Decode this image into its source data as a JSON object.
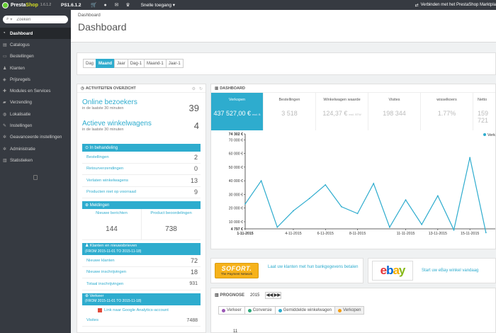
{
  "topbar": {
    "logo_presta": "Presta",
    "logo_shop": "Shop",
    "logo_version": "1.6.1.2",
    "ps_version": "PS1.6.1.2",
    "quick_access": "Snelle toegang",
    "connect": "Verbinden met het PrestaShop Marktpla"
  },
  "sidebar": {
    "search_placeholder": "Zoeken",
    "items": [
      {
        "label": "Dashboard",
        "icon": "speedometer-icon"
      },
      {
        "label": "Catalogus",
        "icon": "book-icon"
      },
      {
        "label": "Bestellingen",
        "icon": "credit-card-icon"
      },
      {
        "label": "Klanten",
        "icon": "user-icon"
      },
      {
        "label": "Prijsregels",
        "icon": "tag-icon"
      },
      {
        "label": "Modules en Services",
        "icon": "puzzle-icon"
      },
      {
        "label": "Verzending",
        "icon": "truck-icon"
      },
      {
        "label": "Lokalisatie",
        "icon": "globe-icon"
      },
      {
        "label": "Instellingen",
        "icon": "wrench-icon"
      },
      {
        "label": "Geavanceerde instellingen",
        "icon": "cogs-icon"
      },
      {
        "label": "Administratie",
        "icon": "gear-icon"
      },
      {
        "label": "Statistieken",
        "icon": "bar-chart-icon"
      }
    ]
  },
  "header": {
    "breadcrumb": "Dashboard",
    "title": "Dashboard"
  },
  "period_buttons": [
    "Dag",
    "Maand",
    "Jaar",
    "Dag-1",
    "Maand-1",
    "Jaar-1"
  ],
  "activity": {
    "title": "ACTIVITEITEN OVERZICHT",
    "online": {
      "label": "Online bezoekers",
      "sub": "in de laatste 30 minuten",
      "value": "39"
    },
    "carts": {
      "label": "Actieve winkelwagens",
      "sub": "in de laatste 30 minuten",
      "value": "4"
    },
    "pending": {
      "title": "In behandeling",
      "rows": [
        {
          "label": "Bestellingen",
          "value": "2"
        },
        {
          "label": "Retourverzendingen",
          "value": "0"
        },
        {
          "label": "Verlaten winkelwagens",
          "value": "13"
        },
        {
          "label": "Producten niet op voorraad",
          "value": "9"
        }
      ]
    },
    "notifications": {
      "title": "Meldingen",
      "new_messages_label": "Nieuwe berichten",
      "new_messages_value": "144",
      "reviews_label": "Product beoordelingen",
      "reviews_value": "738"
    },
    "customers": {
      "title": "Klanten en nieuwsbrieven",
      "range": "(FROM 2015-11-01 TO 2015-11-18)",
      "rows": [
        {
          "label": "Nieuwe klanten",
          "value": "72"
        },
        {
          "label": "Nieuwe inschrijvingen",
          "value": "18"
        },
        {
          "label": "Totaal inschrijvingen",
          "value": "931"
        }
      ]
    },
    "traffic": {
      "title": "Verkeer",
      "range": "(FROM 2015-11-01 TO 2015-11-18)",
      "ga_link": "Link naar Google Analytics-account",
      "visits_label": "Visites",
      "visits_value": "7488"
    }
  },
  "dashboard": {
    "title": "DASHBOARD",
    "kpis": [
      {
        "label": "Verkopen",
        "value": "437 527,00 €",
        "sub": "excl. B",
        "active": true
      },
      {
        "label": "Bestellingen",
        "value": "3 518",
        "sub": ""
      },
      {
        "label": "Winkelwagen waarde",
        "value": "124,37 €",
        "sub": "excl. BTW"
      },
      {
        "label": "Visites",
        "value": "198 344",
        "sub": ""
      },
      {
        "label": "wisselkoers",
        "value": "1.77%",
        "sub": ""
      },
      {
        "label": "Netto",
        "value": "159 721",
        "sub": ""
      }
    ]
  },
  "chart_data": {
    "type": "line",
    "x": [
      "1-11-2015",
      "2-11-2015",
      "3-11-2015",
      "4-11-2015",
      "5-11-2015",
      "6-11-2015",
      "7-11-2015",
      "8-11-2015",
      "9-11-2015",
      "10-11-2015",
      "11-11-2015",
      "12-11-2015",
      "13-11-2015",
      "14-11-2015",
      "15-11-2015",
      "16-11-2015"
    ],
    "xtick_labels": [
      "1-11-2015",
      "4-11-2015",
      "6-11-2015",
      "8-11-2015",
      "11-11-2015",
      "13-11-2015",
      "15-11-2015"
    ],
    "series": [
      {
        "name": "Verkopen",
        "color": "#2eacce",
        "values": [
          23000,
          40000,
          6000,
          18000,
          27000,
          37000,
          21000,
          16000,
          38000,
          6000,
          26000,
          8000,
          29000,
          4000,
          57000,
          2000
        ]
      }
    ],
    "ylim": [
      4797,
      74302
    ],
    "ytick_labels": [
      "74 302 €",
      "70 000 €",
      "60 000 €",
      "50 000 €",
      "40 000 €",
      "30 000 €",
      "20 000 €",
      "10 000 €",
      "4 797 €"
    ],
    "ytick_values": [
      74302,
      70000,
      60000,
      50000,
      40000,
      30000,
      20000,
      10000,
      4797
    ],
    "legend_label": "Verkopen",
    "legend_position": "top-right"
  },
  "ads": {
    "sofort_logo": "SOFORT.",
    "sofort_sub": "The Payment Network",
    "sofort_text": "Laat uw klanten met hun bankgegevens betalen",
    "ebay_logo": [
      "e",
      "b",
      "a",
      "y"
    ],
    "ebay_text": "Start uw eBay winkel vandaag"
  },
  "prognose": {
    "title": "PROGNOSE",
    "year": "2015",
    "prev_label": "◀◀",
    "next_label": "▶▶",
    "tabs": [
      {
        "label": "Verkeer",
        "color": "#9b59b6"
      },
      {
        "label": "Conversie",
        "color": "#2ea87a"
      },
      {
        "label": "Gemiddelde winkelwagen",
        "color": "#2eacce"
      },
      {
        "label": "Verkopen",
        "color": "#f39c12",
        "active": true
      }
    ],
    "tick": "11"
  }
}
